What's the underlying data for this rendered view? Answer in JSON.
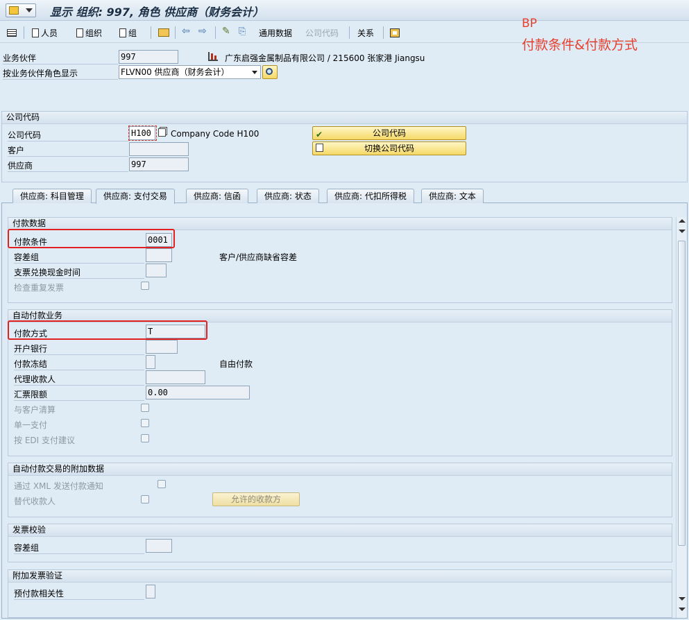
{
  "title": "显示 组织: 997, 角色 供应商（财务会计）",
  "annotation": {
    "line1": "BP",
    "line2": "付款条件&付款方式"
  },
  "toolbar": {
    "person": "人员",
    "org": "组织",
    "group": "组",
    "general_data": "通用数据",
    "company_code": "公司代码",
    "relations": "关系"
  },
  "header": {
    "partner_label": "业务伙伴",
    "partner_value": "997",
    "partner_desc": "广东启强金属制品有限公司 / 215600 张家港 Jiangsu",
    "role_label": "按业务伙伴角色显示",
    "role_value": "FLVN00 供应商（财务会计）"
  },
  "company_section": {
    "title": "公司代码",
    "cc_label": "公司代码",
    "cc_value": "H100",
    "cc_desc": "Company Code H100",
    "customer_label": "客户",
    "customer_value": "",
    "vendor_label": "供应商",
    "vendor_value": "997",
    "btn_company_code": "公司代码",
    "btn_switch": "切换公司代码"
  },
  "tabs": [
    "供应商: 科目管理",
    "供应商: 支付交易",
    "供应商: 信函",
    "供应商: 状态",
    "供应商: 代扣所得税",
    "供应商: 文本"
  ],
  "payment_data": {
    "title": "付款数据",
    "terms_label": "付款条件",
    "terms_value": "0001",
    "tolerance_label": "容差组",
    "tolerance_value": "",
    "tolerance_desc": "客户/供应商缺省容差",
    "cheque_label": "支票兑换现金时间",
    "cheque_value": "",
    "dup_label": "检查重复发票"
  },
  "auto_payment": {
    "title": "自动付款业务",
    "method_label": "付款方式",
    "method_value": "T",
    "bank_label": "开户银行",
    "bank_value": "",
    "block_label": "付款冻结",
    "block_value": "",
    "block_desc": "自由付款",
    "payee_label": "代理收款人",
    "payee_value": "",
    "bill_label": "汇票限额",
    "bill_value": "0.00",
    "clear_label": "与客户清算",
    "single_label": "单一支付",
    "edi_label": "按 EDI 支付建议"
  },
  "auto_payment_extra": {
    "title": "自动付款交易的附加数据",
    "xml_label": "通过 XML 发送付款通知",
    "alt_label": "替代收款人",
    "allowed_btn": "允许的收款方"
  },
  "invoice_verification": {
    "title": "发票校验",
    "tolerance_label": "容差组",
    "tolerance_value": ""
  },
  "additional_invoice": {
    "title": "附加发票验证",
    "prepay_label": "预付款相关性"
  }
}
